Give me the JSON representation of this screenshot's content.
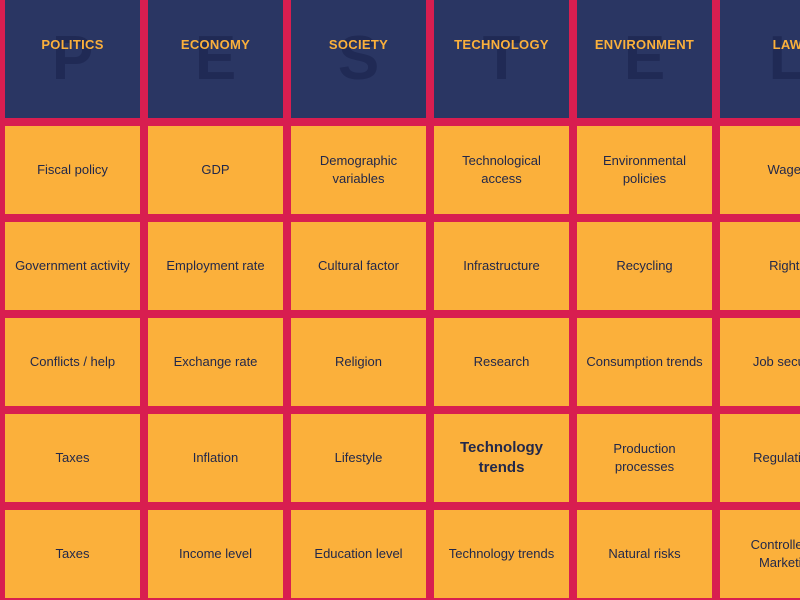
{
  "palette": {
    "background": "#d81e50",
    "header_bg": "#2a3663",
    "header_letter": "#202a55",
    "header_label": "#fbb03b",
    "cell_bg": "#fbb03b",
    "cell_text": "#22284a"
  },
  "framework": {
    "name": "PESTEL",
    "columns": [
      {
        "label": "POLITICS",
        "letter": "P"
      },
      {
        "label": "ECONOMY",
        "letter": "E"
      },
      {
        "label": "SOCIETY",
        "letter": "S"
      },
      {
        "label": "TECHNOLOGY",
        "letter": "T"
      },
      {
        "label": "ENVIRONMENT",
        "letter": "E"
      },
      {
        "label": "LAW",
        "letter": "L"
      }
    ]
  },
  "rows": [
    {
      "cells": [
        "Fiscal policy",
        "GDP",
        "Demographic variables",
        "Technological access",
        "Environmental policies",
        "Wages"
      ]
    },
    {
      "cells": [
        "Government activity",
        "Employment rate",
        "Cultural factor",
        "Infrastructure",
        "Recycling",
        "Rights"
      ]
    },
    {
      "cells": [
        "Conflicts / help",
        "Exchange rate",
        "Religion",
        "Research",
        "Consumption trends",
        "Job security"
      ]
    },
    {
      "cells": [
        "Taxes",
        "Inflation",
        "Lifestyle",
        "Technology trends",
        "Production processes",
        "Regulations"
      ],
      "emphasis": [
        3
      ]
    },
    {
      "cells": [
        "Taxes",
        "Income level",
        "Education level",
        "Technology trends",
        "Natural risks",
        "Controlled of Marketing"
      ]
    }
  ]
}
